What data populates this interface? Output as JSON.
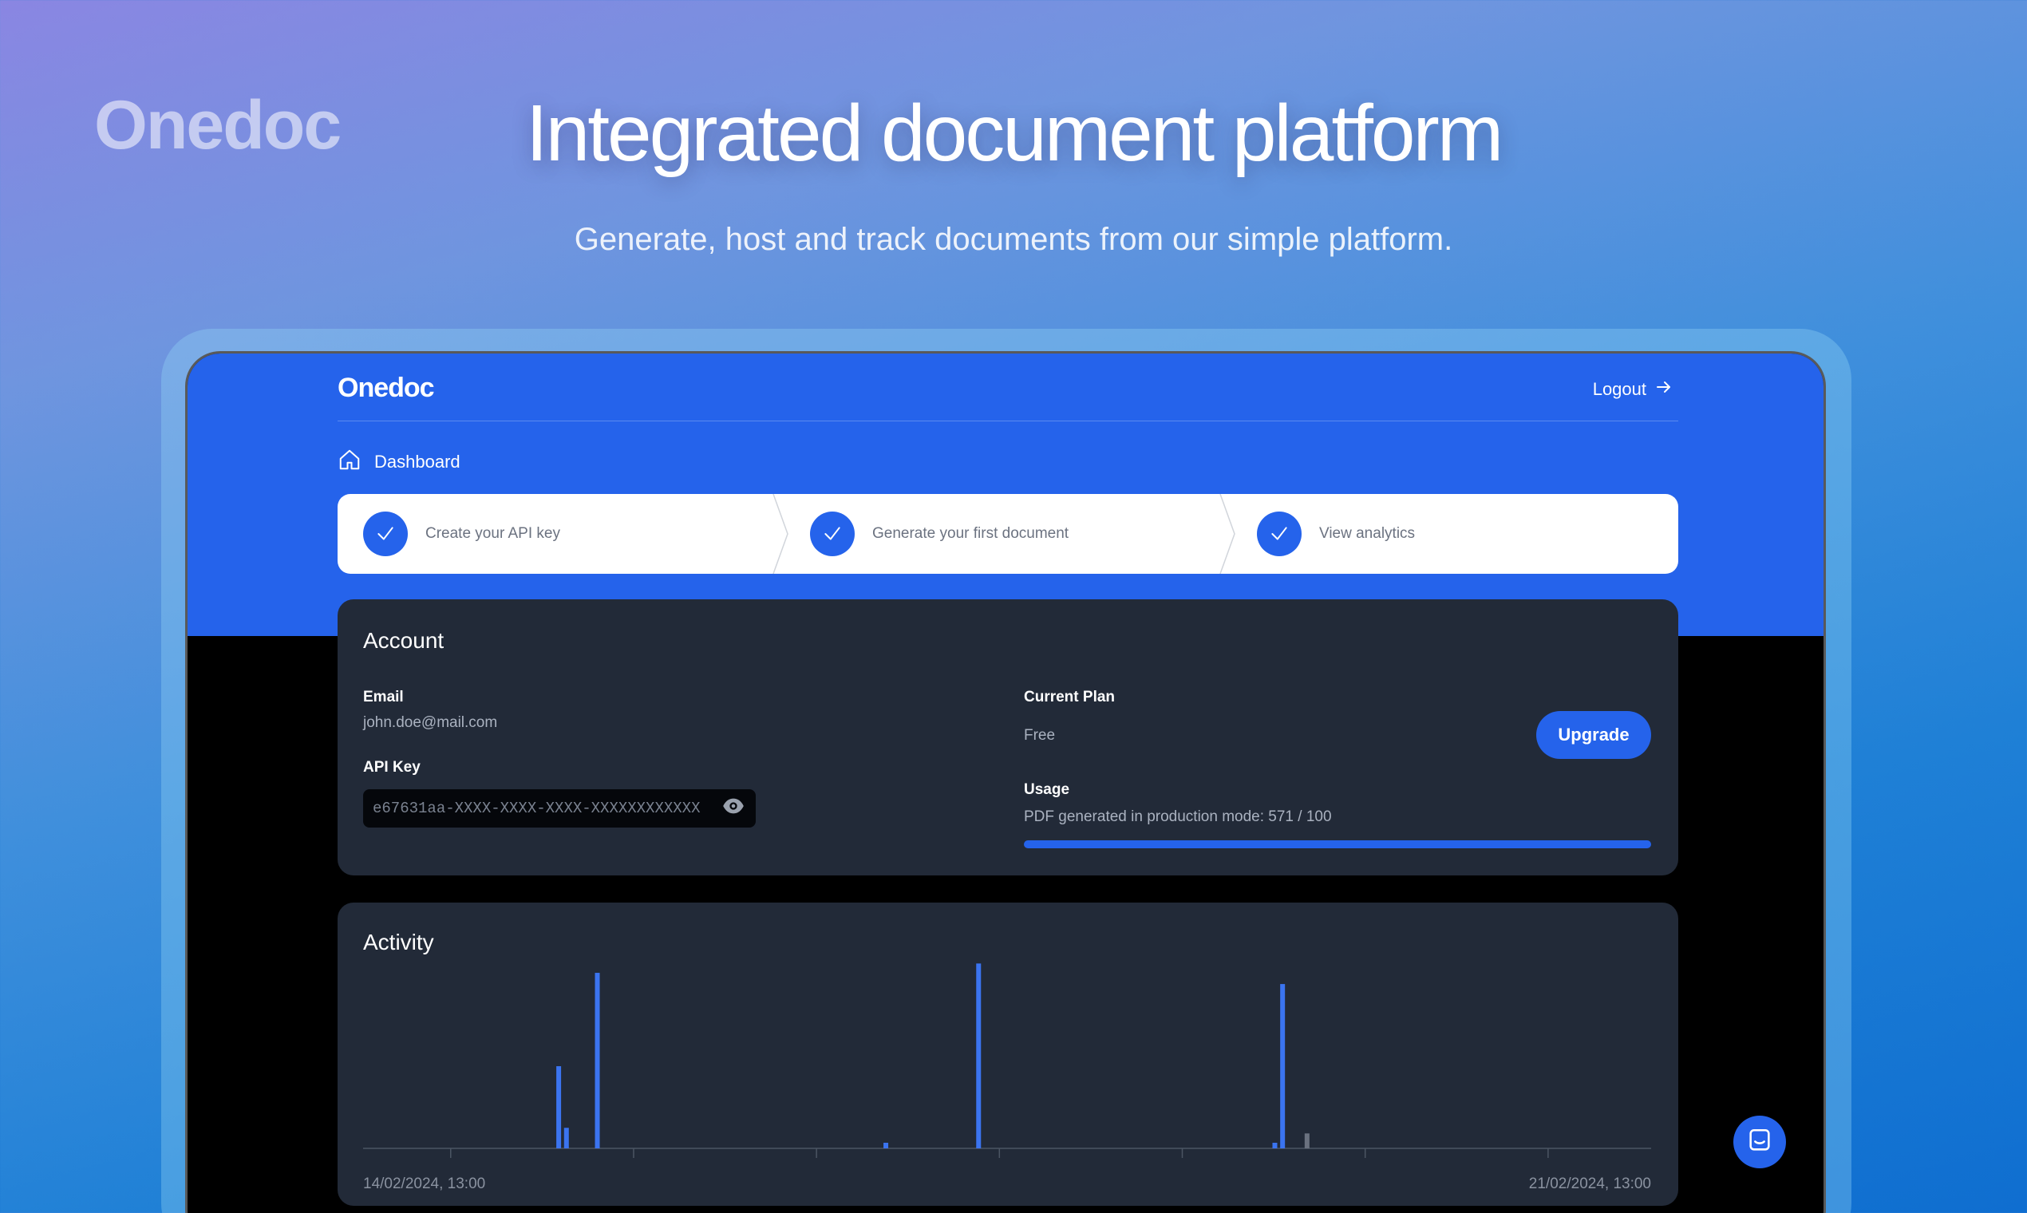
{
  "brand": {
    "logo_text": "Onedoc"
  },
  "hero": {
    "title": "Integrated document platform",
    "subtitle": "Generate, host and track documents from our simple platform."
  },
  "app": {
    "logo_text": "Onedoc",
    "logout_label": "Logout",
    "breadcrumb": "Dashboard",
    "steps": [
      {
        "label": "Create your API key",
        "done": true
      },
      {
        "label": "Generate your first document",
        "done": true
      },
      {
        "label": "View analytics",
        "done": true
      }
    ]
  },
  "account": {
    "title": "Account",
    "email_label": "Email",
    "email_value": "john.doe@mail.com",
    "api_key_label": "API Key",
    "api_key_value": "e67631aa-XXXX-XXXX-XXXX-XXXXXXXXXXXX",
    "plan_label": "Current Plan",
    "plan_value": "Free",
    "upgrade_label": "Upgrade",
    "usage_label": "Usage",
    "usage_text": "PDF generated in production mode: 571 / 100",
    "usage_progress_fraction": 1.0
  },
  "activity": {
    "title": "Activity",
    "start_label": "14/02/2024, 13:00",
    "end_label": "21/02/2024, 13:00"
  },
  "chart_data": {
    "type": "bar",
    "x_range": [
      "14/02/2024, 13:00",
      "21/02/2024, 13:00"
    ],
    "tick_count": 7,
    "grid": false,
    "ylim": [
      0,
      100
    ],
    "series": [
      {
        "color": "#3b74f0",
        "points": [
          {
            "x": 0.15,
            "y": 44
          },
          {
            "x": 0.156,
            "y": 11
          },
          {
            "x": 0.18,
            "y": 94
          },
          {
            "x": 0.404,
            "y": 3
          },
          {
            "x": 0.476,
            "y": 99
          },
          {
            "x": 0.706,
            "y": 3
          },
          {
            "x": 0.712,
            "y": 88
          }
        ]
      },
      {
        "color": "#6b7280",
        "points": [
          {
            "x": 0.731,
            "y": 8
          }
        ]
      }
    ]
  },
  "colors": {
    "primary": "#2563eb",
    "card": "#222a38",
    "check_icon": "#ffffff"
  }
}
